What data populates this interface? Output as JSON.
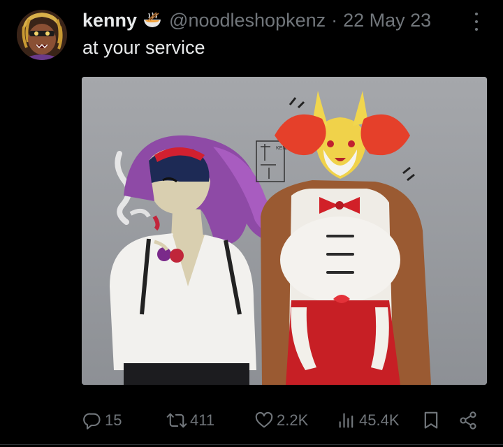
{
  "tweet": {
    "author": {
      "display_name": "kenny",
      "name_emoji": "ramen-bowl-icon",
      "handle": "@noodleshopkenz",
      "separator": "·",
      "date": "22 May 23"
    },
    "text": "at your service",
    "media": {
      "artist_signature": "KENZ"
    },
    "stats": {
      "replies": "15",
      "reposts": "411",
      "likes": "2.2K",
      "views": "45.4K"
    }
  },
  "colors": {
    "background": "#000000",
    "text_primary": "#e7e9ea",
    "text_secondary": "#71767b",
    "divider": "#2f3336"
  }
}
